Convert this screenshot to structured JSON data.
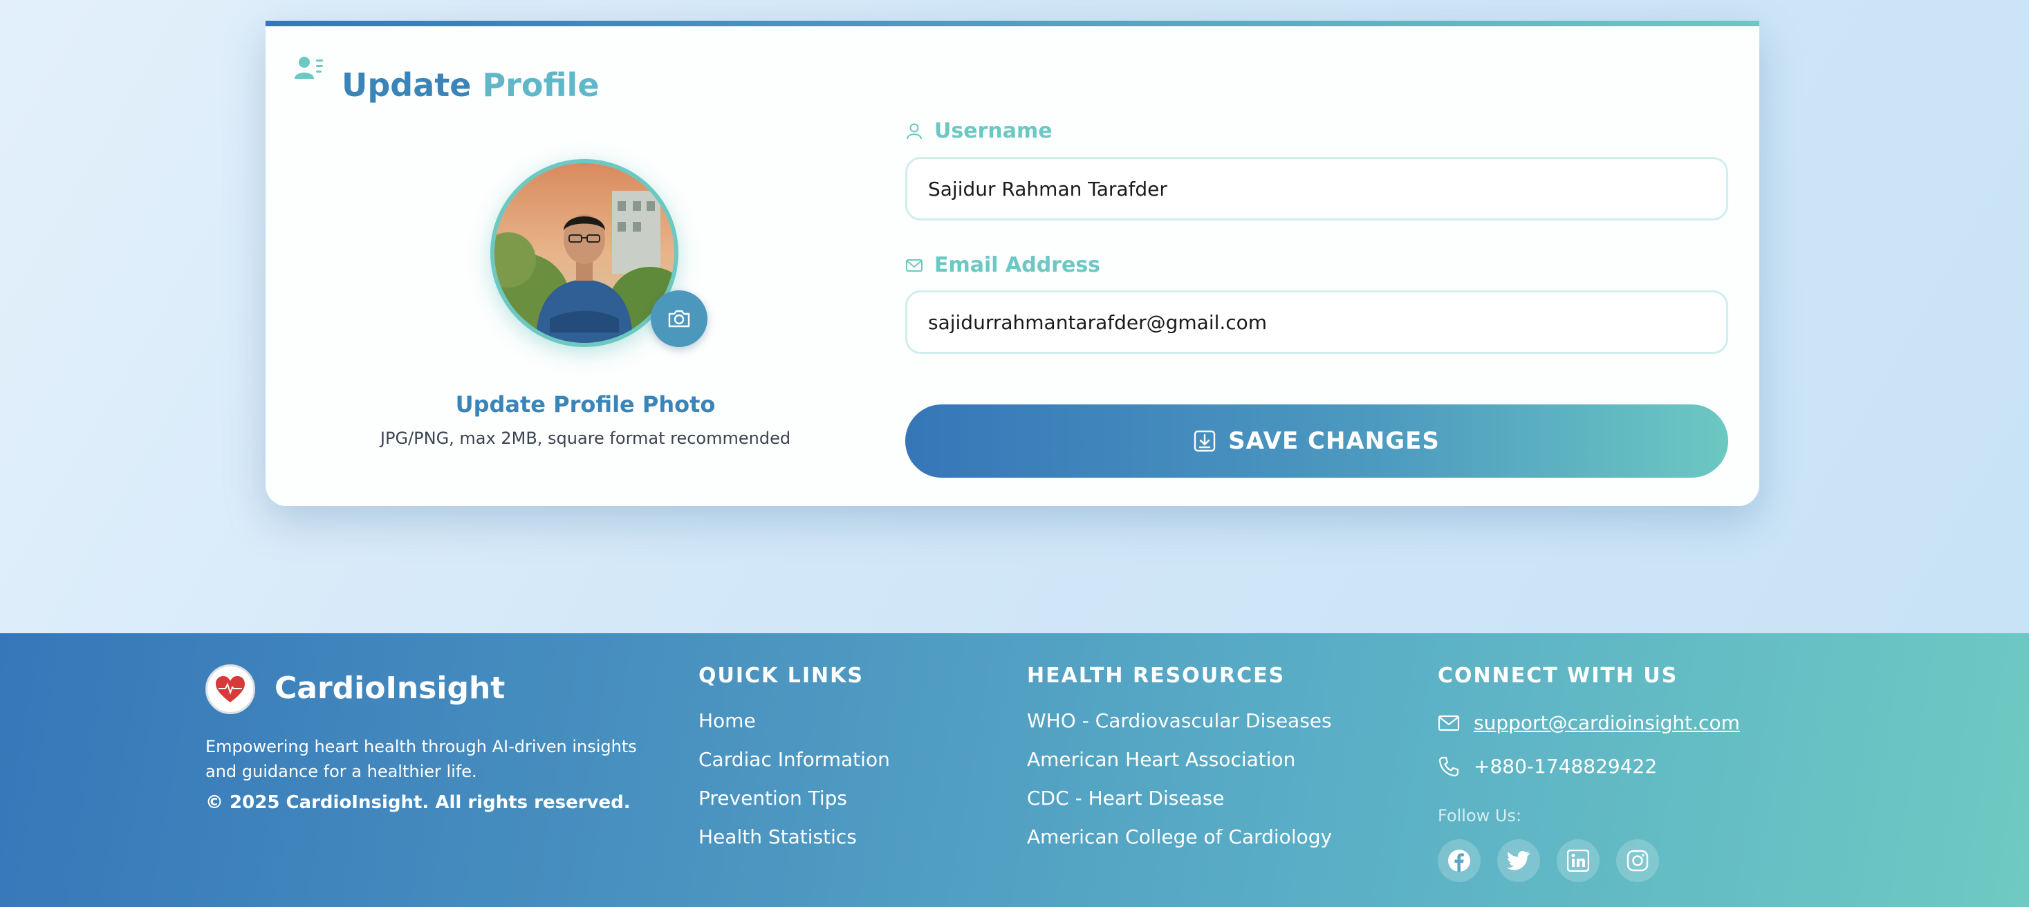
{
  "profile_card": {
    "title_part1": "Update",
    "title_part2": "Profile",
    "title_icon": "user-list-icon",
    "photo_title": "Update Profile Photo",
    "photo_hint": "JPG/PNG, max 2MB, square format recommended",
    "camera_icon": "camera-icon",
    "username_label": "Username",
    "username_value": "Sajidur Rahman Tarafder",
    "email_label": "Email Address",
    "email_value": "sajidurrahmantarafder@gmail.com",
    "save_label": "SAVE CHANGES",
    "save_icon": "download-icon"
  },
  "footer": {
    "brand": "CardioInsight",
    "description": "Empowering heart health through AI-driven insights and guidance for a healthier life.",
    "copyright": "© 2025 CardioInsight. All rights reserved.",
    "quick_links": {
      "heading": "QUICK LINKS",
      "items": [
        "Home",
        "Cardiac Information",
        "Prevention Tips",
        "Health Statistics"
      ]
    },
    "health_resources": {
      "heading": "HEALTH RESOURCES",
      "items": [
        "WHO - Cardiovascular Diseases",
        "American Heart Association",
        "CDC - Heart Disease",
        "American College of Cardiology"
      ]
    },
    "connect": {
      "heading": "CONNECT WITH US",
      "email": "support@cardioinsight.com",
      "phone": "+880-1748829422",
      "follow_label": "Follow Us:",
      "socials": [
        "facebook-icon",
        "twitter-icon",
        "linkedin-icon",
        "instagram-icon"
      ]
    }
  },
  "colors": {
    "accent_blue": "#3676b8",
    "accent_teal": "#6cc8c2",
    "title_blue": "#3a84b8"
  }
}
